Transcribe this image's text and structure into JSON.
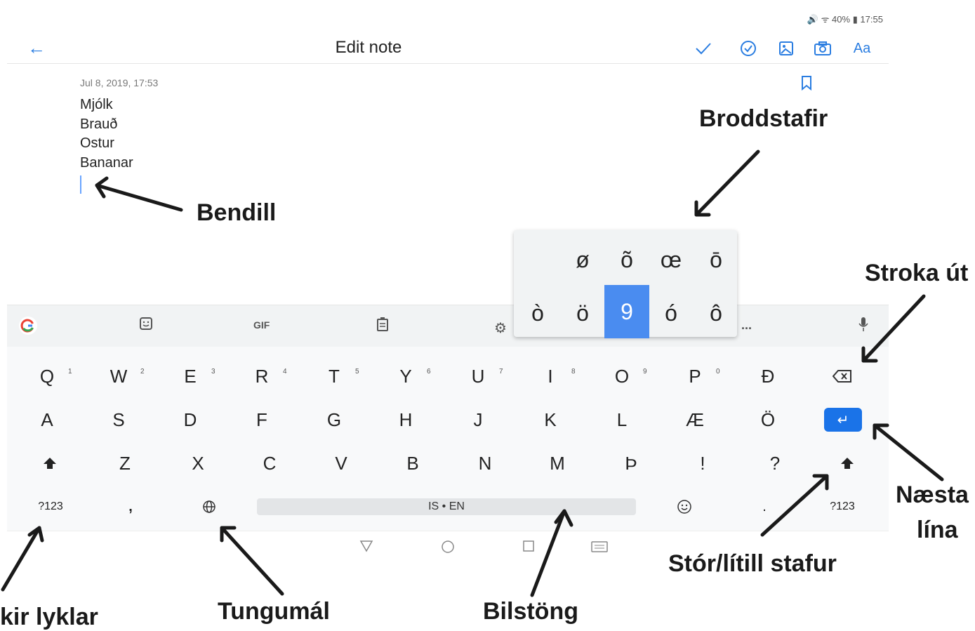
{
  "status_bar": "🔊 ᯤ 40% ▮ 17:55",
  "header": {
    "title": "Edit note",
    "text_style_label": "Aa"
  },
  "note": {
    "date": "Jul 8, 2019, 17:53",
    "lines": [
      "Mjólk",
      "Brauð",
      "Ostur",
      "Bananar"
    ]
  },
  "toolbar": {
    "gif_label": "GIF",
    "more_label": "..."
  },
  "keyboard": {
    "row1": [
      "Q",
      "W",
      "E",
      "R",
      "T",
      "Y",
      "U",
      "I",
      "O",
      "P",
      "Đ"
    ],
    "hints": [
      "1",
      "2",
      "3",
      "4",
      "5",
      "6",
      "7",
      "8",
      "9",
      "0"
    ],
    "row2": [
      "A",
      "S",
      "D",
      "F",
      "G",
      "H",
      "J",
      "K",
      "L",
      "Æ",
      "Ö"
    ],
    "row3": [
      "Z",
      "X",
      "C",
      "V",
      "B",
      "N",
      "M",
      "Þ",
      "!",
      "?"
    ],
    "symbols_label": "?123",
    "comma": ",",
    "period": ".",
    "space_label": "IS • EN"
  },
  "accent_popup": {
    "row1": [
      "ø",
      "õ",
      "œ",
      "ō"
    ],
    "row2": [
      "ò",
      "ö",
      "9",
      "ó",
      "ô"
    ]
  },
  "annotations": {
    "bendill": "Bendill",
    "broddstafir": "Broddstafir",
    "stroka_ut": "Stroka út",
    "naesta_lina_1": "Næsta",
    "naesta_lina_2": "lína",
    "stor_litill": "Stór/lítill stafur",
    "taknlyklar": "kir lyklar",
    "tungumal": "Tungumál",
    "bilstong": "Bilstöng"
  },
  "colors": {
    "accent": "#1a73e8",
    "icon_blue": "#2a7de1",
    "popup_selected": "#4a8cf0"
  }
}
